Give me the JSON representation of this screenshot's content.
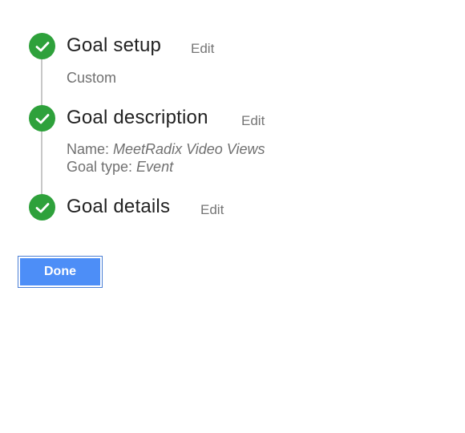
{
  "steps": [
    {
      "title": "Goal setup",
      "edit_label": "Edit",
      "summary": [
        "Custom"
      ]
    },
    {
      "title": "Goal description",
      "edit_label": "Edit",
      "name_label": "Name: ",
      "name_value": "MeetRadix Video Views",
      "type_label": "Goal type: ",
      "type_value": "Event"
    },
    {
      "title": "Goal details",
      "edit_label": "Edit"
    }
  ],
  "done_label": "Done",
  "colors": {
    "check_green": "#2ea13b",
    "button_blue": "#4d8ef7",
    "connector_gray": "#c8c8c8"
  },
  "icons": {
    "step_complete": "checkmark-circle-icon"
  }
}
